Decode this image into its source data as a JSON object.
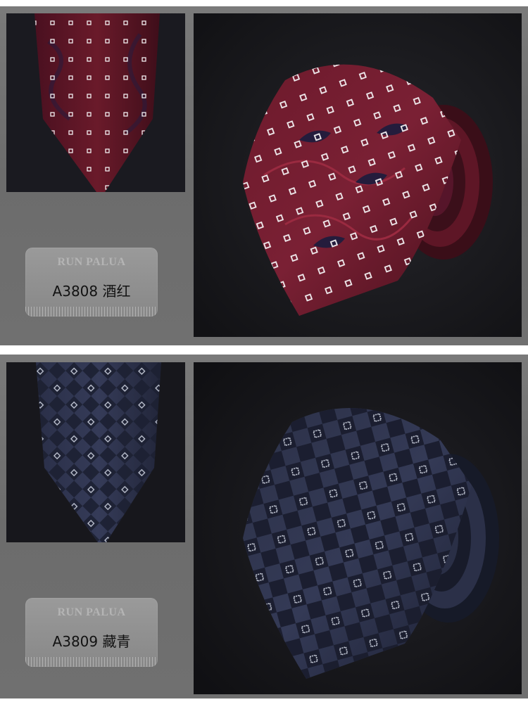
{
  "products": [
    {
      "brand": "RUN PALUA",
      "code_label": "A3808 酒红",
      "colors": {
        "base": "#5a1420",
        "dark": "#241018",
        "motif": "#201a3a",
        "vine": "#8a2235",
        "dot": "#f2eef0"
      }
    },
    {
      "brand": "RUN PALUA",
      "code_label": "A3809 藏青",
      "colors": {
        "base": "#262a40",
        "dark": "#14151f",
        "motif": "#1e2234",
        "vine": "#2f3550",
        "dot": "#d6dbe8"
      }
    }
  ]
}
